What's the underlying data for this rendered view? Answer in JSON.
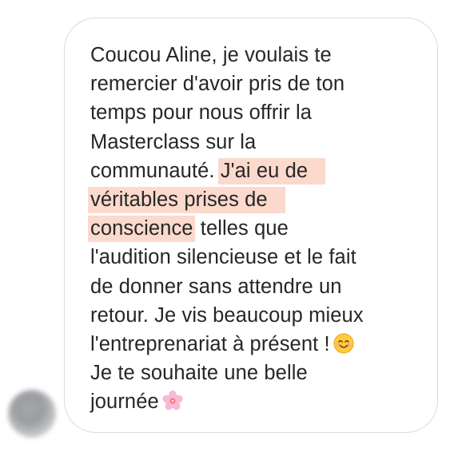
{
  "message": {
    "lines": [
      "Coucou Aline, je voulais te",
      "remercier d'avoir pris de ton",
      "temps pour nous offrir la",
      "Masterclass sur la",
      "communauté.",
      "J'ai eu de",
      "véritables prises de",
      "conscience",
      "telles que",
      "l'audition silencieuse et le fait",
      "de donner sans attendre un",
      "retour. Je vis beaucoup mieux",
      "l'entreprenariat à présent !",
      "Je te souhaite une belle",
      "journée"
    ],
    "highlight_color": "#fbd9cc",
    "text_color": "#262626",
    "emoji_1": "smiling-face-emoji",
    "emoji_2": "cherry-blossom-emoji"
  },
  "avatar": {
    "style": "blurred"
  }
}
